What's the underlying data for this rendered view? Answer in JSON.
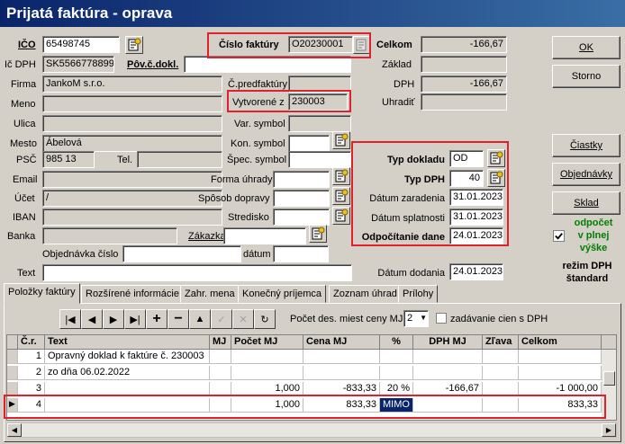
{
  "window": {
    "title": "Prijatá faktúra  - oprava"
  },
  "left": {
    "ico_label": "IČO",
    "ico_value": "65498745",
    "icdph_label": "Ič DPH",
    "icdph_value": "SK5566778899",
    "povcdokl_label": "Pôv.č.dokl.",
    "firma_label": "Firma",
    "firma_value": "JankoM s.r.o.",
    "meno_label": "Meno",
    "ulica_label": "Ulica",
    "mesto_label": "Mesto",
    "mesto_value": "Ábelová",
    "psc_label": "PSČ",
    "psc_value": "985 13",
    "tel_label": "Tel.",
    "email_label": "Email",
    "ucet_label": "Účet",
    "ucet_value": "/",
    "iban_label": "IBAN",
    "banka_label": "Banka",
    "objednavka_label": "Objednávka číslo",
    "datum_label": "dátum",
    "text_label": "Text"
  },
  "middle": {
    "cislo_faktury_label": "Číslo faktúry",
    "cislo_faktury_value": "O20230001",
    "cpredfaktury_label": "Č.predfaktúry",
    "vytvorene_label": "Vytvorené z",
    "vytvorene_value": "230003",
    "var_symbol_label": "Var. symbol",
    "kon_symbol_label": "Kon. symbol",
    "spec_symbol_label": "Špec. symbol",
    "forma_uhrady_label": "Forma úhrady",
    "sposob_dopravy_label": "Spôsob dopravy",
    "stredisko_label": "Stredisko",
    "zakazka_label": "Zákazka"
  },
  "right": {
    "celkom_label": "Celkom",
    "celkom_value": "-166,67",
    "zaklad_label": "Základ",
    "dph_label": "DPH",
    "dph_value": "-166,67",
    "uhradit_label": "Uhradiť",
    "typ_dokladu_label": "Typ dokladu",
    "typ_dokladu_value": "OD",
    "typ_dph_label": "Typ DPH",
    "typ_dph_value": "40",
    "datum_zaradenia_label": "Dátum zaradenia",
    "datum_zaradenia_value": "31.01.2023",
    "datum_splatnosti_label": "Dátum splatnosti",
    "datum_splatnosti_value": "31.01.2023",
    "odpocitanie_label": "Odpočítanie dane",
    "odpocitanie_value": "24.01.2023",
    "datum_dodania_label": "Dátum dodania",
    "datum_dodania_value": "24.01.2023"
  },
  "buttons": {
    "ok": "OK",
    "storno": "Storno",
    "ciastky": "Čiastky",
    "objednavky": "Objednávky",
    "sklad": "Sklad"
  },
  "odpocet": {
    "line1": "odpočet",
    "line2": "v plnej",
    "line3": "výške"
  },
  "rezim": {
    "line1": "režim DPH",
    "line2": "štandard"
  },
  "tabs": [
    "Položky faktúry",
    "Rozšírené informácie",
    "Zahr. mena",
    "Konečný príjemca",
    "Zoznam úhrad",
    "Prílohy"
  ],
  "toolbar": {
    "pocet_label": "Počet des. miest ceny MJ",
    "pocet_value": "2",
    "zadavanie_label": "zadávanie cien s DPH"
  },
  "grid": {
    "headers": [
      "Č.r.",
      "Text",
      "MJ",
      "Počet MJ",
      "Cena MJ",
      "%",
      "DPH MJ",
      "Zľava",
      "Celkom"
    ],
    "rows": [
      [
        "1",
        "Opravný doklad k faktúre č. 230003",
        "",
        "",
        "",
        "",
        "",
        "",
        ""
      ],
      [
        "2",
        "zo dňa 06.02.2022",
        "",
        "",
        "",
        "",
        "",
        "",
        ""
      ],
      [
        "3",
        "",
        "",
        "1,000",
        "-833,33",
        "20 %",
        "-166,67",
        "",
        "-1 000,00"
      ],
      [
        "4",
        "",
        "",
        "1,000",
        "833,33",
        "MIMO",
        "",
        "",
        "833,33"
      ]
    ]
  }
}
